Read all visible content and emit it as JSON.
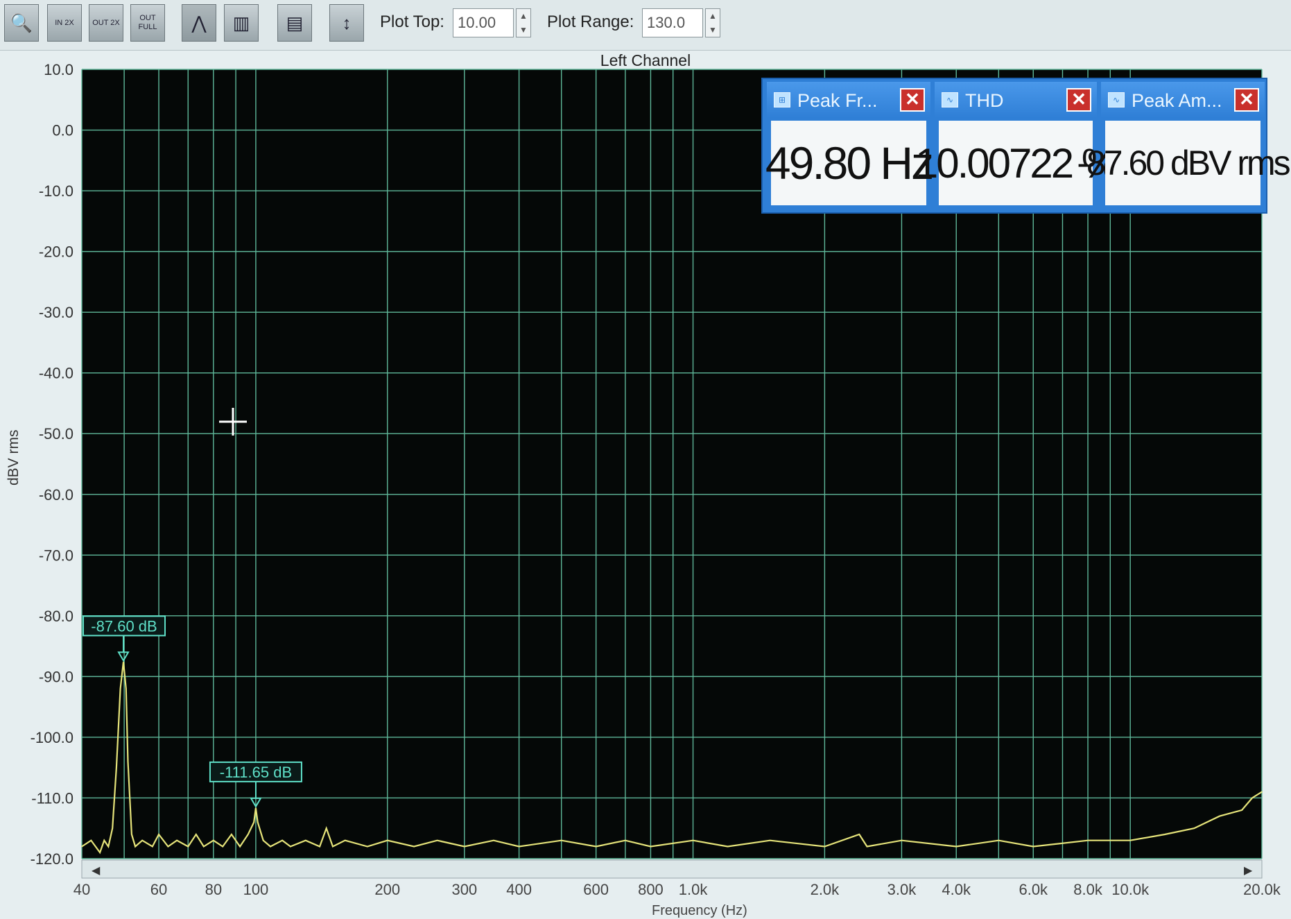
{
  "toolbar": {
    "buttons": [
      {
        "name": "zoom-icon",
        "glyph": "🔍"
      },
      {
        "name": "zoom-in-2x-icon",
        "glyph": "IN 2X"
      },
      {
        "name": "zoom-out-2x-icon",
        "glyph": "OUT 2X"
      },
      {
        "name": "zoom-out-full-icon",
        "glyph": "OUT FULL"
      },
      {
        "name": "line-graph-icon",
        "glyph": "⋀"
      },
      {
        "name": "bar-graph-icon",
        "glyph": "▥"
      },
      {
        "name": "layout-icon",
        "glyph": "▤"
      },
      {
        "name": "vertical-range-icon",
        "glyph": "↕"
      }
    ],
    "plot_top_label": "Plot Top:",
    "plot_top_value": "10.00",
    "plot_range_label": "Plot Range:",
    "plot_range_value": "130.0"
  },
  "chart_title": "Left Channel",
  "meters": [
    {
      "title": "Peak Fr...",
      "value": "49.80 Hz"
    },
    {
      "title": "THD",
      "value": "10.00722 %"
    },
    {
      "title": "Peak Am...",
      "value": "-87.60 dBV rms"
    }
  ],
  "colors": {
    "plot_bg": "#050807",
    "grid": "#5fb89a",
    "trace": "#e6e47a",
    "marker": "#5fe0c8",
    "meter_blue": "#2f7fd6"
  },
  "chart_data": {
    "type": "line",
    "xlabel": "Frequency (Hz)",
    "ylabel": "dBV rms",
    "xscale": "log",
    "xlim": [
      40,
      20000
    ],
    "ylim": [
      -120,
      10
    ],
    "yticks": [
      "10.0",
      "0.0",
      "-10.0",
      "-20.0",
      "-30.0",
      "-40.0",
      "-50.0",
      "-60.0",
      "-70.0",
      "-80.0",
      "-90.0",
      "-100.0",
      "-110.0",
      "-120.0"
    ],
    "xticks": [
      {
        "v": 40,
        "label": "40"
      },
      {
        "v": 60,
        "label": "60"
      },
      {
        "v": 80,
        "label": "80"
      },
      {
        "v": 100,
        "label": "100"
      },
      {
        "v": 200,
        "label": "200"
      },
      {
        "v": 300,
        "label": "300"
      },
      {
        "v": 400,
        "label": "400"
      },
      {
        "v": 600,
        "label": "600"
      },
      {
        "v": 800,
        "label": "800"
      },
      {
        "v": 1000,
        "label": "1.0k"
      },
      {
        "v": 2000,
        "label": "2.0k"
      },
      {
        "v": 3000,
        "label": "3.0k"
      },
      {
        "v": 4000,
        "label": "4.0k"
      },
      {
        "v": 6000,
        "label": "6.0k"
      },
      {
        "v": 8000,
        "label": "8.0k"
      },
      {
        "v": 10000,
        "label": "10.0k"
      },
      {
        "v": 20000,
        "label": "20.0k"
      }
    ],
    "series": [
      {
        "points": [
          [
            40,
            -118
          ],
          [
            42,
            -117
          ],
          [
            44,
            -119
          ],
          [
            45,
            -117
          ],
          [
            46,
            -118
          ],
          [
            47,
            -115
          ],
          [
            48,
            -105
          ],
          [
            49,
            -92
          ],
          [
            49.8,
            -87.6
          ],
          [
            50.5,
            -92
          ],
          [
            51,
            -104
          ],
          [
            52,
            -116
          ],
          [
            53,
            -118
          ],
          [
            55,
            -117
          ],
          [
            58,
            -118
          ],
          [
            60,
            -116
          ],
          [
            63,
            -118
          ],
          [
            66,
            -117
          ],
          [
            70,
            -118
          ],
          [
            73,
            -116
          ],
          [
            76,
            -118
          ],
          [
            80,
            -117
          ],
          [
            84,
            -118
          ],
          [
            88,
            -116
          ],
          [
            92,
            -118
          ],
          [
            96,
            -116
          ],
          [
            99,
            -114
          ],
          [
            100,
            -111.65
          ],
          [
            101,
            -114
          ],
          [
            104,
            -117
          ],
          [
            108,
            -118
          ],
          [
            115,
            -117
          ],
          [
            120,
            -118
          ],
          [
            130,
            -117
          ],
          [
            140,
            -118
          ],
          [
            145,
            -115
          ],
          [
            150,
            -118
          ],
          [
            160,
            -117
          ],
          [
            180,
            -118
          ],
          [
            200,
            -117
          ],
          [
            230,
            -118
          ],
          [
            260,
            -117
          ],
          [
            300,
            -118
          ],
          [
            350,
            -117
          ],
          [
            400,
            -118
          ],
          [
            500,
            -117
          ],
          [
            600,
            -118
          ],
          [
            700,
            -117
          ],
          [
            800,
            -118
          ],
          [
            1000,
            -117
          ],
          [
            1200,
            -118
          ],
          [
            1500,
            -117
          ],
          [
            2000,
            -118
          ],
          [
            2400,
            -116
          ],
          [
            2500,
            -118
          ],
          [
            3000,
            -117
          ],
          [
            4000,
            -118
          ],
          [
            5000,
            -117
          ],
          [
            6000,
            -118
          ],
          [
            8000,
            -117
          ],
          [
            10000,
            -117
          ],
          [
            12000,
            -116
          ],
          [
            14000,
            -115
          ],
          [
            16000,
            -113
          ],
          [
            18000,
            -112
          ],
          [
            19000,
            -110
          ],
          [
            20000,
            -109
          ]
        ]
      }
    ],
    "annotations": [
      {
        "label": "-87.60 dB",
        "x": 49.8,
        "y": -87.6
      },
      {
        "label": "-111.65 dB",
        "x": 100,
        "y": -111.65
      }
    ]
  }
}
